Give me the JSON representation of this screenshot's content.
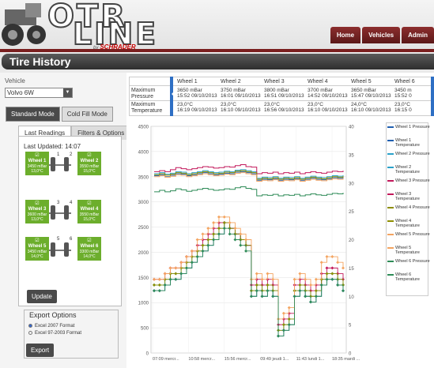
{
  "header": {
    "logo_top": "OTR",
    "logo_bottom": "LINE",
    "partner_by": "by",
    "partner": "SCHRADER",
    "nav": [
      {
        "label": "Home"
      },
      {
        "label": "Vehicles"
      },
      {
        "label": "Admin"
      }
    ]
  },
  "page": {
    "title": "Tire History"
  },
  "sidebar": {
    "vehicle_label": "Vehicle",
    "vehicle_value": "Volvo 6W",
    "modes": [
      {
        "label": "Standard Mode",
        "active": true
      },
      {
        "label": "Cold Fill Mode",
        "active": false
      }
    ],
    "tabs": [
      {
        "label": "Last Readings",
        "active": true
      },
      {
        "label": "Filters & Options",
        "active": false
      }
    ],
    "last_updated": "Last Updated: 14:07",
    "axle_numbers": [
      "1",
      "2",
      "3",
      "4",
      "5",
      "6"
    ],
    "wheels": [
      {
        "name": "Wheel 1",
        "pressure": "3450 mBar",
        "temp": "13,0°C"
      },
      {
        "name": "Wheel 2",
        "pressure": "3550 mBar",
        "temp": "15,0°C"
      },
      {
        "name": "Wheel 3",
        "pressure": "3600 mBar",
        "temp": "13,0°C"
      },
      {
        "name": "Wheel 4",
        "pressure": "3550 mBar",
        "temp": "15,0°C"
      },
      {
        "name": "Wheel 5",
        "pressure": "3450 mBar",
        "temp": "14,0°C"
      },
      {
        "name": "Wheel 6",
        "pressure": "3300 mBar",
        "temp": "14,0°C"
      }
    ],
    "update_label": "Update",
    "export": {
      "title": "Export Options",
      "options": [
        {
          "label": "Excel 2007 Format",
          "selected": true
        },
        {
          "label": "Excel 97-2003 Format",
          "selected": false
        }
      ],
      "button": "Export"
    }
  },
  "wheel_table": {
    "row_labels": [
      {
        "line1": "Maximum",
        "line2": "Pressure"
      },
      {
        "line1": "Maximum",
        "line2": "Temperature"
      }
    ],
    "columns": [
      {
        "name": "Wheel 1",
        "pressure": "3650 mBar",
        "pressure_time": "15:52 09/10/2013",
        "temp": "23,0°C",
        "temp_time": "16:19 09/10/2013"
      },
      {
        "name": "Wheel 2",
        "pressure": "3750 mBar",
        "pressure_time": "16:01 09/10/2013",
        "temp": "23,0°C",
        "temp_time": "16:10 09/10/2013"
      },
      {
        "name": "Wheel 3",
        "pressure": "3800 mBar",
        "pressure_time": "16:51 09/10/2013",
        "temp": "23,0°C",
        "temp_time": "16:56 09/10/2013"
      },
      {
        "name": "Wheel 4",
        "pressure": "3700 mBar",
        "pressure_time": "14:52 09/10/2013",
        "temp": "23,0°C",
        "temp_time": "16:10 09/10/2013"
      },
      {
        "name": "Wheel 5",
        "pressure": "3650 mBar",
        "pressure_time": "15:47 09/10/2013",
        "temp": "24,0°C",
        "temp_time": "16:10 09/10/2013"
      },
      {
        "name": "Wheel 6",
        "pressure": "3450 m",
        "pressure_time": "15:52 0",
        "temp": "23,0°C",
        "temp_time": "16:15 0"
      }
    ]
  },
  "chart_data": {
    "type": "line",
    "left_axis_ticks": [
      "0",
      "500",
      "1000",
      "1500",
      "2000",
      "2500",
      "3000",
      "3500",
      "4000",
      "4500"
    ],
    "right_axis_ticks": [
      "0",
      "5",
      "10",
      "15",
      "20",
      "25",
      "30",
      "35",
      "40"
    ],
    "x_tick_labels": [
      "07:09 mercr...",
      "10:58 mercr...",
      "15:56 mercr...",
      "09:49 jeudi 1...",
      "11:43 lundi 1...",
      "18:35 mardi ..."
    ],
    "ylim_left": [
      0,
      4500
    ],
    "ylim_right": [
      0,
      40
    ],
    "grid": true,
    "legend_position": "right",
    "series": [
      {
        "name": "Wheel 1 Pressure",
        "axis": "left",
        "color": "#1f5fb0",
        "values": [
          3520,
          3540,
          3500,
          3530,
          3560,
          3550,
          3520,
          3540,
          3560,
          3580,
          3560,
          3540,
          3550,
          3570,
          3560,
          3590,
          3600,
          3580,
          3560,
          3430,
          3450,
          3440,
          3460,
          3430,
          3450,
          3440,
          3460,
          3430,
          3450,
          3470,
          3450,
          3440,
          3460,
          3480,
          3470,
          3490
        ]
      },
      {
        "name": "Wheel 1 Temperature",
        "axis": "right",
        "color": "#1f5fb0",
        "values": [
          11,
          11,
          12,
          13,
          13,
          14,
          15,
          16,
          17,
          18,
          19,
          20,
          21,
          23,
          22,
          21,
          20,
          19,
          10,
          11,
          10,
          11,
          10,
          3,
          4,
          5,
          10,
          11,
          10,
          9,
          10,
          12,
          13,
          13,
          12,
          11
        ]
      },
      {
        "name": "Wheel 2 Pressure",
        "axis": "left",
        "color": "#2aa1c9",
        "values": [
          3560,
          3580,
          3550,
          3570,
          3600,
          3590,
          3560,
          3580,
          3600,
          3620,
          3600,
          3580,
          3590,
          3610,
          3600,
          3630,
          3640,
          3620,
          3600,
          3470,
          3490,
          3480,
          3500,
          3470,
          3490,
          3480,
          3500,
          3470,
          3490,
          3510,
          3490,
          3480,
          3500,
          3520,
          3510,
          3530
        ]
      },
      {
        "name": "Wheel 2 Temperature",
        "axis": "right",
        "color": "#2aa1c9",
        "values": [
          12,
          12,
          13,
          14,
          14,
          15,
          16,
          17,
          18,
          19,
          20,
          21,
          22,
          23,
          22,
          21,
          20,
          19,
          11,
          12,
          11,
          12,
          11,
          4,
          5,
          6,
          11,
          12,
          11,
          10,
          11,
          13,
          14,
          14,
          13,
          12
        ]
      },
      {
        "name": "Wheel 3 Pressure",
        "axis": "left",
        "color": "#c2185b",
        "values": [
          3600,
          3620,
          3600,
          3640,
          3680,
          3660,
          3640,
          3660,
          3680,
          3700,
          3690,
          3670,
          3680,
          3700,
          3690,
          3720,
          3740,
          3700,
          3690,
          3560,
          3580,
          3570,
          3590,
          3560,
          3580,
          3570,
          3590,
          3560,
          3580,
          3600,
          3580,
          3570,
          3590,
          3610,
          3600,
          3620
        ]
      },
      {
        "name": "Wheel 3 Temperature",
        "axis": "right",
        "color": "#c2185b",
        "values": [
          13,
          13,
          14,
          15,
          15,
          16,
          17,
          18,
          19,
          20,
          21,
          22,
          23,
          23,
          22,
          21,
          20,
          19,
          12,
          13,
          12,
          13,
          12,
          5,
          6,
          7,
          12,
          13,
          12,
          11,
          12,
          14,
          15,
          15,
          14,
          13
        ]
      },
      {
        "name": "Wheel 4 Pressure",
        "axis": "left",
        "color": "#8e8e00",
        "values": [
          3540,
          3560,
          3530,
          3550,
          3580,
          3570,
          3540,
          3560,
          3580,
          3600,
          3580,
          3560,
          3570,
          3590,
          3580,
          3610,
          3620,
          3600,
          3580,
          3450,
          3470,
          3460,
          3480,
          3450,
          3470,
          3460,
          3480,
          3450,
          3470,
          3490,
          3470,
          3460,
          3480,
          3500,
          3490,
          3510
        ]
      },
      {
        "name": "Wheel 4 Temperature",
        "axis": "right",
        "color": "#8e8e00",
        "values": [
          12,
          12,
          13,
          14,
          14,
          15,
          16,
          17,
          18,
          19,
          20,
          21,
          22,
          23,
          22,
          21,
          20,
          19,
          11,
          12,
          11,
          12,
          11,
          4,
          5,
          6,
          11,
          12,
          11,
          10,
          11,
          13,
          14,
          14,
          13,
          12
        ]
      },
      {
        "name": "Wheel 5 Pressure",
        "axis": "left",
        "color": "#f4a460",
        "values": [
          3500,
          3520,
          3490,
          3510,
          3540,
          3530,
          3500,
          3520,
          3540,
          3560,
          3540,
          3520,
          3530,
          3550,
          3540,
          3570,
          3580,
          3560,
          3540,
          3410,
          3430,
          3420,
          3440,
          3410,
          3430,
          3420,
          3440,
          3410,
          3430,
          3450,
          3430,
          3420,
          3440,
          3460,
          3450,
          3470
        ]
      },
      {
        "name": "Wheel 5 Temperature",
        "axis": "right",
        "color": "#f4a460",
        "values": [
          13,
          13,
          14,
          15,
          15,
          16,
          17,
          18,
          20,
          21,
          22,
          23,
          24,
          24,
          23,
          22,
          21,
          20,
          13,
          14,
          13,
          14,
          13,
          6,
          7,
          8,
          13,
          14,
          13,
          12,
          13,
          16,
          17,
          17,
          16,
          15
        ]
      },
      {
        "name": "Wheel 6 Pressure",
        "axis": "left",
        "color": "#2e8b57",
        "values": [
          3200,
          3230,
          3200,
          3220,
          3260,
          3240,
          3210,
          3230,
          3250,
          3270,
          3250,
          3230,
          3240,
          3260,
          3250,
          3280,
          3300,
          3270,
          3250,
          3120,
          3140,
          3130,
          3150,
          3120,
          3140,
          3130,
          3150,
          3120,
          3140,
          3160,
          3140,
          3130,
          3150,
          3170,
          3160,
          3180
        ]
      },
      {
        "name": "Wheel 6 Temperature",
        "axis": "right",
        "color": "#2e8b57",
        "values": [
          11,
          11,
          12,
          13,
          13,
          14,
          15,
          16,
          17,
          18,
          19,
          20,
          21,
          22,
          21,
          20,
          19,
          18,
          10,
          11,
          10,
          11,
          10,
          3,
          4,
          5,
          10,
          11,
          10,
          9,
          10,
          12,
          13,
          13,
          12,
          11
        ]
      }
    ]
  },
  "legend": [
    {
      "label": "Wheel 1 Pressure",
      "color": "#1f5fb0"
    },
    {
      "label": "Wheel 1 Temperature",
      "color": "#1f5fb0"
    },
    {
      "label": "Wheel 2 Pressure",
      "color": "#2aa1c9"
    },
    {
      "label": "Wheel 2 Temperature",
      "color": "#2aa1c9"
    },
    {
      "label": "Wheel 3 Pressure",
      "color": "#c2185b"
    },
    {
      "label": "Wheel 3 Temperature",
      "color": "#c2185b"
    },
    {
      "label": "Wheel 4 Pressure",
      "color": "#8e8e00"
    },
    {
      "label": "Wheel 4 Temperature",
      "color": "#8e8e00"
    },
    {
      "label": "Wheel 5 Pressure",
      "color": "#f4a460"
    },
    {
      "label": "Wheel 5 Temperature",
      "color": "#f4a460"
    },
    {
      "label": "Wheel 6 Pressure",
      "color": "#2e8b57"
    },
    {
      "label": "Wheel 6 Temperature",
      "color": "#2e8b57"
    }
  ]
}
